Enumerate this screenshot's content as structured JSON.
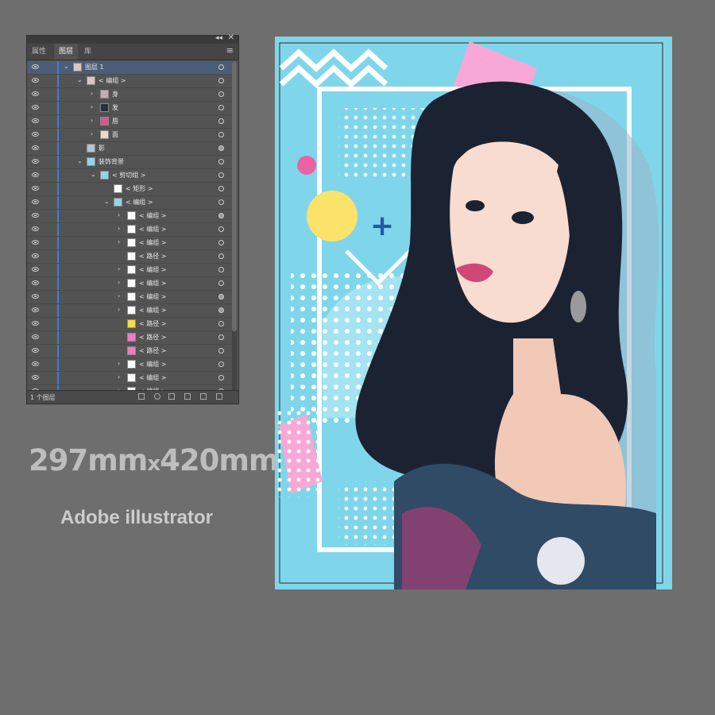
{
  "panel": {
    "tabs": [
      {
        "label": "属性",
        "active": false
      },
      {
        "label": "图层",
        "active": true
      },
      {
        "label": "库",
        "active": false
      }
    ],
    "layers": [
      {
        "label": "图层 1",
        "depth": 0,
        "chevron": "down",
        "thumb": "portrait",
        "selected": true,
        "target": "empty"
      },
      {
        "label": "< 编组 >",
        "depth": 1,
        "chevron": "down",
        "thumb": "portrait",
        "target": "empty"
      },
      {
        "label": "身",
        "depth": 2,
        "chevron": "right",
        "thumb": "body",
        "target": "empty"
      },
      {
        "label": "发",
        "depth": 2,
        "chevron": "right",
        "thumb": "hair",
        "target": "empty"
      },
      {
        "label": "唇",
        "depth": 2,
        "chevron": "right",
        "thumb": "lips",
        "target": "empty"
      },
      {
        "label": "面",
        "depth": 2,
        "chevron": "right",
        "thumb": "face",
        "target": "empty"
      },
      {
        "label": "影",
        "depth": 1,
        "chevron": "",
        "thumb": "shadow",
        "target": "filled"
      },
      {
        "label": "装饰背景",
        "depth": 1,
        "chevron": "down",
        "thumb": "pattern",
        "target": "empty"
      },
      {
        "label": "< 剪切组 >",
        "depth": 2,
        "chevron": "down",
        "thumb": "pattern",
        "target": "empty"
      },
      {
        "label": "< 矩形 >",
        "depth": 3,
        "chevron": "",
        "thumb": "white",
        "target": "empty"
      },
      {
        "label": "< 编组 >",
        "depth": 3,
        "chevron": "down",
        "thumb": "pattern",
        "target": "empty"
      },
      {
        "label": "< 编组 >",
        "depth": 4,
        "chevron": "right",
        "thumb": "white",
        "target": "filled"
      },
      {
        "label": "< 编组 >",
        "depth": 4,
        "chevron": "right",
        "thumb": "white",
        "target": "empty"
      },
      {
        "label": "< 编组 >",
        "depth": 4,
        "chevron": "right",
        "thumb": "white",
        "target": "empty"
      },
      {
        "label": "< 路径 >",
        "depth": 4,
        "chevron": "",
        "thumb": "white",
        "target": "empty"
      },
      {
        "label": "< 编组 >",
        "depth": 4,
        "chevron": "right",
        "thumb": "white",
        "target": "empty"
      },
      {
        "label": "< 编组 >",
        "depth": 4,
        "chevron": "right",
        "thumb": "white",
        "target": "empty"
      },
      {
        "label": "< 编组 >",
        "depth": 4,
        "chevron": "right",
        "thumb": "white",
        "target": "filled"
      },
      {
        "label": "< 编组 >",
        "depth": 4,
        "chevron": "right",
        "thumb": "white",
        "target": "filled"
      },
      {
        "label": "< 路径 >",
        "depth": 4,
        "chevron": "",
        "thumb": "yellow",
        "target": "empty"
      },
      {
        "label": "< 路径 >",
        "depth": 4,
        "chevron": "",
        "thumb": "pink",
        "target": "empty"
      },
      {
        "label": "< 路径 >",
        "depth": 4,
        "chevron": "",
        "thumb": "pink",
        "target": "empty"
      },
      {
        "label": "< 编组 >",
        "depth": 4,
        "chevron": "right",
        "thumb": "white",
        "target": "empty"
      },
      {
        "label": "< 编组 >",
        "depth": 4,
        "chevron": "right",
        "thumb": "white",
        "target": "empty"
      },
      {
        "label": "< 编组 >",
        "depth": 4,
        "chevron": "right",
        "thumb": "white",
        "target": "empty"
      },
      {
        "label": "< 编组 >",
        "depth": 4,
        "chevron": "right",
        "thumb": "white",
        "target": "empty"
      }
    ],
    "footer_count": "1 个图层"
  },
  "canvas": {
    "size_main": "297mm",
    "size_x": "x",
    "size_tail": "420mm",
    "app_name": "Adobe illustrator"
  },
  "colors": {
    "cyan": "#7fd6ea",
    "pink": "#f7a8d6",
    "yellow": "#fbe36a",
    "hair": "#1b2333",
    "skin": "#f1c9b6",
    "lips": "#d2477a",
    "panel_selected": "#4b5d78",
    "layer_bar": "#3d7de0"
  }
}
